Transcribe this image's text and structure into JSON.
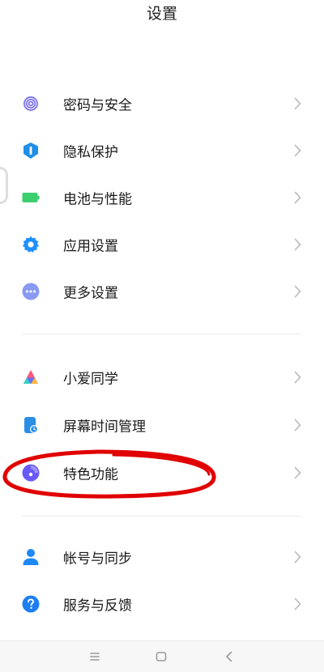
{
  "header": {
    "title": "设置"
  },
  "sections": [
    {
      "items": [
        {
          "label": "密码与安全",
          "icon": "fingerprint-icon",
          "color": "#6b63e6"
        },
        {
          "label": "隐私保护",
          "icon": "privacy-shield-icon",
          "color": "#1f8fe8"
        },
        {
          "label": "电池与性能",
          "icon": "battery-icon",
          "color": "#3ccf6e"
        },
        {
          "label": "应用设置",
          "icon": "gear-icon",
          "color": "#1e90ff"
        },
        {
          "label": "更多设置",
          "icon": "more-dots-icon",
          "color": "#7a8cf0"
        }
      ]
    },
    {
      "items": [
        {
          "label": "小爱同学",
          "icon": "xiaoai-assistant-icon",
          "color": "#6a6cf5"
        },
        {
          "label": "屏幕时间管理",
          "icon": "screen-time-icon",
          "color": "#2b8ee6"
        },
        {
          "label": "特色功能",
          "icon": "special-features-icon",
          "color": "#6a5af9"
        }
      ]
    },
    {
      "items": [
        {
          "label": "帐号与同步",
          "icon": "account-icon",
          "color": "#1e88f5"
        },
        {
          "label": "服务与反馈",
          "icon": "help-icon",
          "color": "#1e7ef0"
        }
      ]
    }
  ],
  "annotation": {
    "target": "特色功能",
    "color": "#e00000"
  },
  "navbar": {
    "buttons": [
      "menu-button",
      "home-button",
      "back-button"
    ]
  }
}
